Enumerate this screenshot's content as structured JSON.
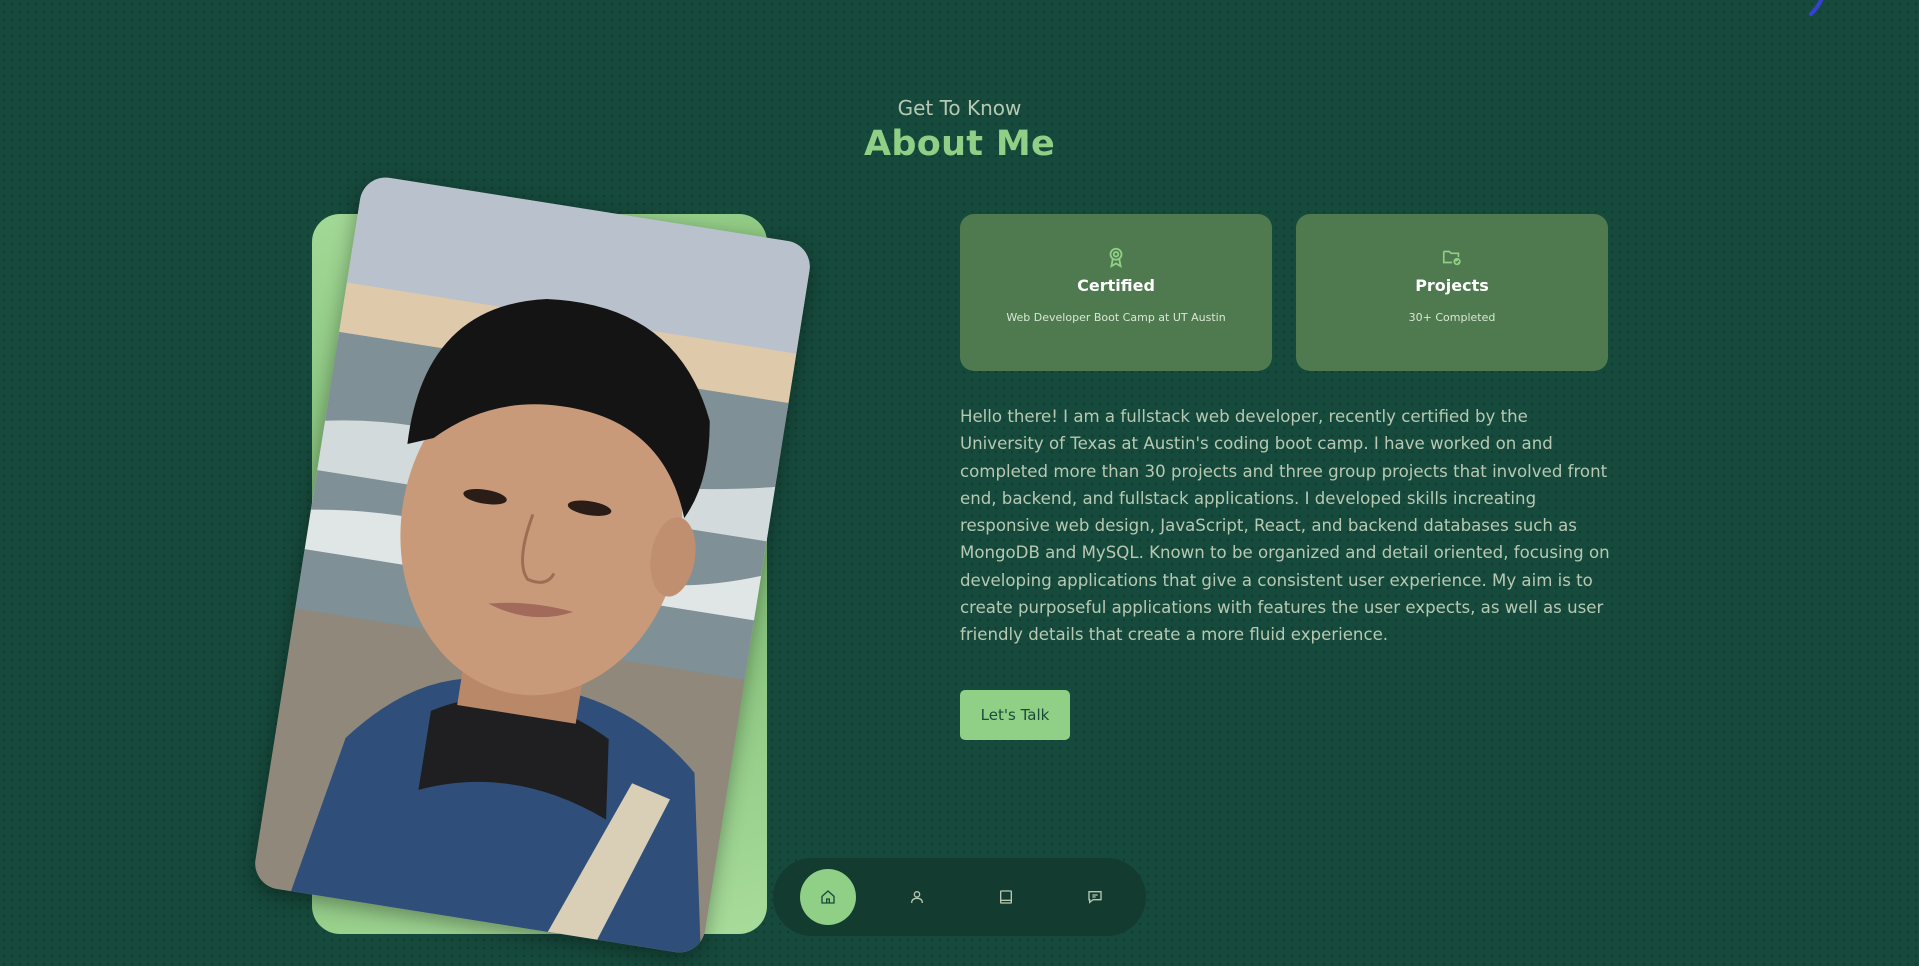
{
  "header": {
    "eyebrow": "Get To Know",
    "title": "About Me"
  },
  "photo": {
    "alt": "Portrait of the developer at the beach",
    "icon": "profile-photo"
  },
  "cards": [
    {
      "icon": "award-icon",
      "title": "Certified",
      "subtitle": "Web Developer Boot Camp at UT Austin"
    },
    {
      "icon": "folder-check-icon",
      "title": "Projects",
      "subtitle": "30+ Completed"
    }
  ],
  "bio": "Hello there! I am a fullstack web developer, recently certified by the University of Texas at Austin's coding boot camp. I have worked on and completed more than 30 projects and three group projects that involved front end, backend, and fullstack applications. I developed skills increating responsive web design, JavaScript, React, and backend databases such as MongoDB and MySQL. Known to be organized and detail oriented, focusing on developing applications that give a consistent user experience. My aim is to create purposeful applications with features the user expects, as well as user friendly details that create a more fluid experience.",
  "cta": {
    "label": "Let's Talk"
  },
  "nav": {
    "items": [
      {
        "icon": "home-icon",
        "active": true
      },
      {
        "icon": "user-icon",
        "active": false
      },
      {
        "icon": "book-icon",
        "active": false
      },
      {
        "icon": "message-icon",
        "active": false
      }
    ]
  },
  "colors": {
    "background": "#164a3c",
    "accent": "#8fcf86",
    "card": "#4f7a4f",
    "nav": "#143b2f"
  }
}
